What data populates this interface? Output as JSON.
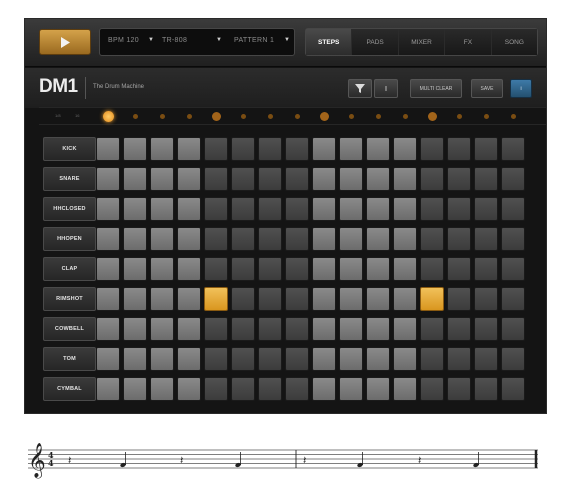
{
  "toolbar": {
    "play_icon": "play-icon",
    "selectors": [
      {
        "label": "BPM 120"
      },
      {
        "label": "TR-808"
      },
      {
        "label": "PATTERN 1"
      }
    ],
    "tabs": [
      {
        "label": "STEPS",
        "active": true
      },
      {
        "label": "PADS",
        "active": false
      },
      {
        "label": "MIXER",
        "active": false
      },
      {
        "label": "FX",
        "active": false
      },
      {
        "label": "SONG",
        "active": false
      }
    ]
  },
  "header": {
    "logo": "DM1",
    "subtitle": "The Drum Machine",
    "buttons": {
      "icon_button": "funnel-icon",
      "second_button": "||",
      "clear": "MULTI CLEAR",
      "save": "SAVE",
      "info": "i"
    }
  },
  "step_row": {
    "left_label": "1/8",
    "right_label": "16",
    "current_step": 1,
    "accent_color": "#e38a1c"
  },
  "tracks": [
    {
      "name": "KICK",
      "active_steps": []
    },
    {
      "name": "SNARE",
      "active_steps": []
    },
    {
      "name": "HHCLOSED",
      "active_steps": []
    },
    {
      "name": "HHOPEN",
      "active_steps": []
    },
    {
      "name": "CLAP",
      "active_steps": []
    },
    {
      "name": "RIMSHOT",
      "active_steps": [
        5,
        13
      ]
    },
    {
      "name": "COWBELL",
      "active_steps": []
    },
    {
      "name": "TOM",
      "active_steps": []
    },
    {
      "name": "CYMBAL",
      "active_steps": []
    }
  ],
  "grid": {
    "steps": 16,
    "active_color": "#e9ad3c"
  },
  "staff": {
    "clef": "treble-clef-icon",
    "time_signature": "4/4"
  }
}
